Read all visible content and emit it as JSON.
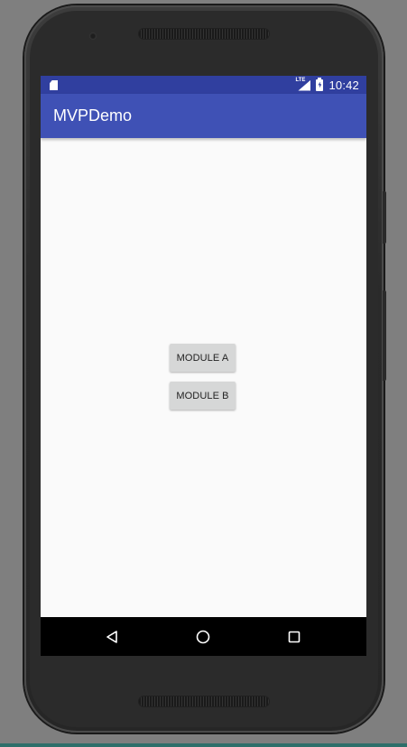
{
  "status_bar": {
    "network_label": "LTE",
    "time": "10:42"
  },
  "app_bar": {
    "title": "MVPDemo"
  },
  "buttons": {
    "module_a": "MODULE A",
    "module_b": "MODULE B"
  },
  "navigation": {
    "back_icon": "back-triangle-icon",
    "home_icon": "home-circle-icon",
    "recents_icon": "recents-square-icon"
  },
  "colors": {
    "status_bar": "#303f9f",
    "app_bar": "#3f51b5",
    "background": "#fafafa",
    "button": "#d6d7d7"
  }
}
